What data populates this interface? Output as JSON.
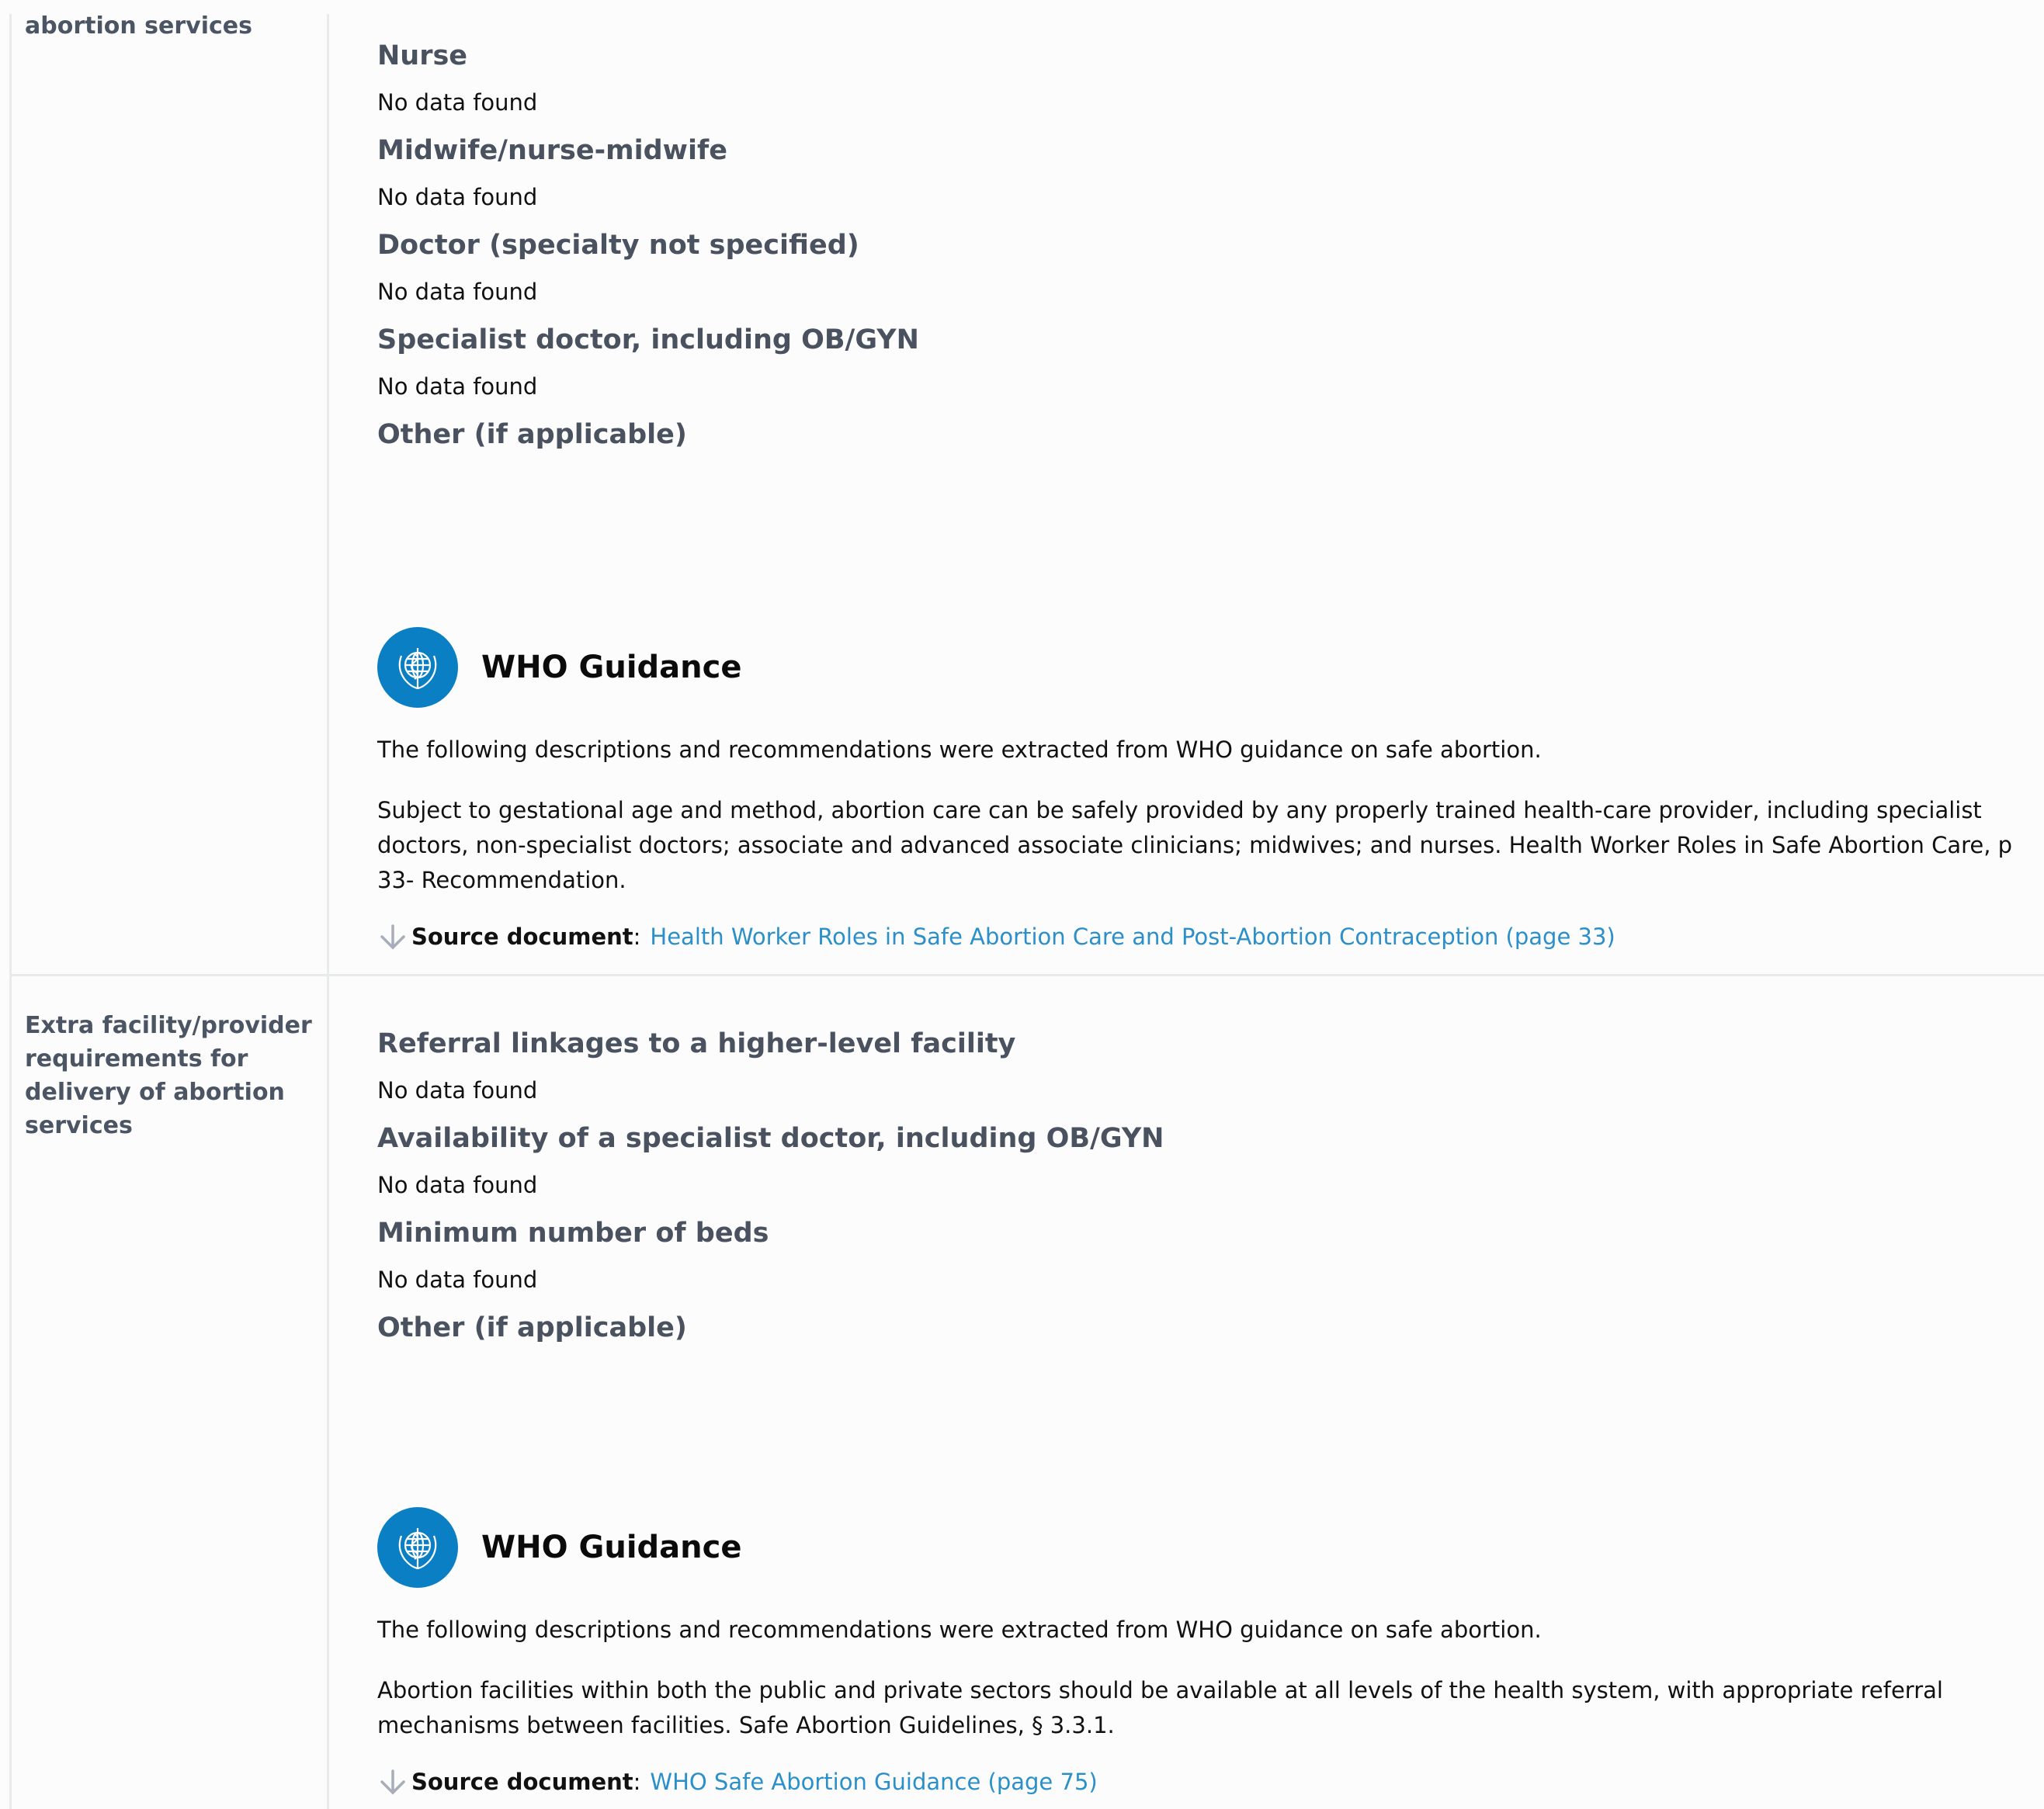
{
  "section1": {
    "row_label": "abortion services",
    "fields": [
      {
        "heading": "Nurse",
        "value": "No data found"
      },
      {
        "heading": "Midwife/nurse-midwife",
        "value": "No data found"
      },
      {
        "heading": "Doctor (specialty not specified)",
        "value": "No data found"
      },
      {
        "heading": "Specialist doctor, including OB/GYN",
        "value": "No data found"
      },
      {
        "heading": "Other (if applicable)",
        "value": ""
      }
    ],
    "who": {
      "title": "WHO Guidance",
      "intro": "The following descriptions and recommendations were extracted from WHO guidance on safe abortion.",
      "text": "Subject to gestational age and method, abortion care can be safely provided by any properly trained health-care provider, including specialist doctors, non-specialist doctors; associate and advanced associate clinicians; midwives; and nurses. Health Worker Roles in Safe Abortion Care, p 33- Recommendation.",
      "source_label": "Source document",
      "source_link": "Health Worker Roles in Safe Abortion Care and Post-Abortion Contraception (page 33)"
    }
  },
  "section2": {
    "row_label": "Extra facility/provider requirements for delivery of abortion services",
    "fields": [
      {
        "heading": "Referral linkages to a higher-level facility",
        "value": "No data found"
      },
      {
        "heading": "Availability of a specialist doctor, including OB/GYN",
        "value": "No data found"
      },
      {
        "heading": "Minimum number of beds",
        "value": "No data found"
      },
      {
        "heading": "Other (if applicable)",
        "value": ""
      }
    ],
    "who": {
      "title": "WHO Guidance",
      "intro": "The following descriptions and recommendations were extracted from WHO guidance on safe abortion.",
      "text": "Abortion facilities within both the public and private sectors should be available at all levels of the health system, with appropriate referral mechanisms between facilities. Safe Abortion Guidelines, § 3.3.1.",
      "source_label": "Source document",
      "source_link": "WHO Safe Abortion Guidance (page 75)"
    }
  },
  "colors": {
    "heading": "#4a5260",
    "link": "#2b8fc9",
    "who_blue": "#0b7fc4"
  },
  "icons": [
    "who-emblem-icon",
    "arrow-down-icon"
  ]
}
